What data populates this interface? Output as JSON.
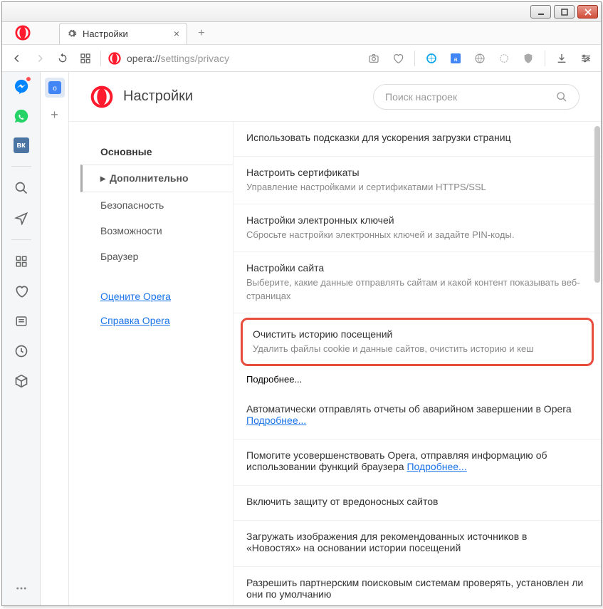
{
  "window": {
    "tab_title": "Настройки",
    "url_prefix": "opera://",
    "url_path": "settings/privacy"
  },
  "sidebar_apps": {
    "vk": "вк"
  },
  "tabcol": {
    "translate": "о",
    "plus": "+"
  },
  "settings_header": {
    "title": "Настройки",
    "search_placeholder": "Поиск настроек"
  },
  "nav": {
    "items": [
      {
        "label": "Основные",
        "kind": "bold"
      },
      {
        "label": "Дополнительно",
        "kind": "active"
      },
      {
        "label": "Безопасность",
        "kind": ""
      },
      {
        "label": "Возможности",
        "kind": ""
      },
      {
        "label": "Браузер",
        "kind": ""
      }
    ],
    "links": [
      {
        "label": "Оцените Opera"
      },
      {
        "label": "Справка Opera"
      }
    ]
  },
  "settings": [
    {
      "title": "Использовать подсказки для ускорения загрузки страниц",
      "desc": ""
    },
    {
      "title": "Настроить сертификаты",
      "desc": "Управление настройками и сертификатами HTTPS/SSL"
    },
    {
      "title": "Настройки электронных ключей",
      "desc": "Сбросьте настройки электронных ключей и задайте PIN-коды."
    },
    {
      "title": "Настройки сайта",
      "desc": "Выберите, какие данные отправлять сайтам и какой контент показывать веб-страницах"
    },
    {
      "title": "Очистить историю посещений",
      "desc": "Удалить файлы cookie и данные сайтов, очистить историю и кеш",
      "highlight": true,
      "more": "Подробнее..."
    },
    {
      "title": "Автоматически отправлять отчеты об аварийном завершении в Opera",
      "more": "Подробнее..."
    },
    {
      "title": "Помогите усовершенствовать Opera, отправляя информацию об использовании функций браузера",
      "more": "Подробнее..."
    },
    {
      "title": "Включить защиту от вредоносных сайтов",
      "desc": ""
    },
    {
      "title": "Загружать изображения для рекомендованных источников в «Новостях» на основании истории посещений",
      "desc": ""
    },
    {
      "title": "Разрешить партнерским поисковым системам проверять, установлен ли они по умолчанию",
      "desc": ""
    }
  ]
}
